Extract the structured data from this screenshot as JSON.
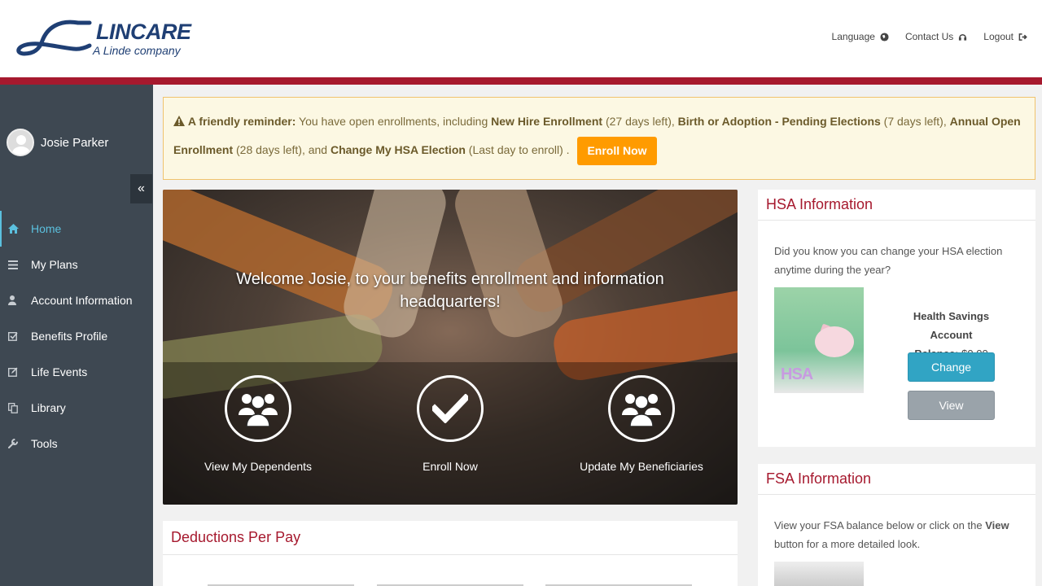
{
  "header": {
    "logo": {
      "name": "LINCARE",
      "tagline": "A Linde company"
    },
    "links": [
      {
        "label": "Language",
        "icon": "globe-icon"
      },
      {
        "label": "Contact Us",
        "icon": "headset-icon"
      },
      {
        "label": "Logout",
        "icon": "logout-icon"
      }
    ],
    "accent_color": "#a6192e"
  },
  "sidebar": {
    "user_name": "Josie Parker",
    "collapse_symbol": "«",
    "items": [
      {
        "label": "Home",
        "icon": "home-icon",
        "active": true
      },
      {
        "label": "My Plans",
        "icon": "list-icon"
      },
      {
        "label": "Account Information",
        "icon": "user-icon"
      },
      {
        "label": "Benefits Profile",
        "icon": "checkbox-icon"
      },
      {
        "label": "Life Events",
        "icon": "edit-icon"
      },
      {
        "label": "Library",
        "icon": "copy-icon"
      },
      {
        "label": "Tools",
        "icon": "wrench-icon"
      }
    ]
  },
  "reminder": {
    "lead": "A friendly reminder:",
    "intro": " You have open enrollments, including ",
    "items": [
      {
        "name": "New Hire Enrollment",
        "days": " (27 days left), "
      },
      {
        "name": "Birth or Adoption - Pending Elections",
        "days": " (7 days left), "
      },
      {
        "name": "Annual Open Enrollment",
        "days": " (28 days left), and "
      },
      {
        "name": "Change My HSA Election",
        "days": " (Last day to enroll) ."
      }
    ],
    "button": "Enroll Now"
  },
  "hero": {
    "title": "Welcome Josie, to your benefits enrollment and information headquarters!",
    "actions": [
      {
        "label": "View My Dependents",
        "icon": "people-icon"
      },
      {
        "label": "Enroll Now",
        "icon": "check-icon"
      },
      {
        "label": "Update My Beneficiaries",
        "icon": "people-icon"
      }
    ]
  },
  "deductions": {
    "title": "Deductions Per Pay"
  },
  "hsa": {
    "title": "HSA Information",
    "text": "Did you know you can change your HSA election anytime during the year?",
    "image_label": "HSA",
    "account_label": "Health Savings Account",
    "balance_label": "Balance:",
    "balance_value": "$0.00",
    "change_button": "Change",
    "view_button": "View"
  },
  "fsa": {
    "title": "FSA Information",
    "text_before": "View your FSA balance below or click on the ",
    "text_bold": "View",
    "text_after": " button for a more detailed look."
  }
}
